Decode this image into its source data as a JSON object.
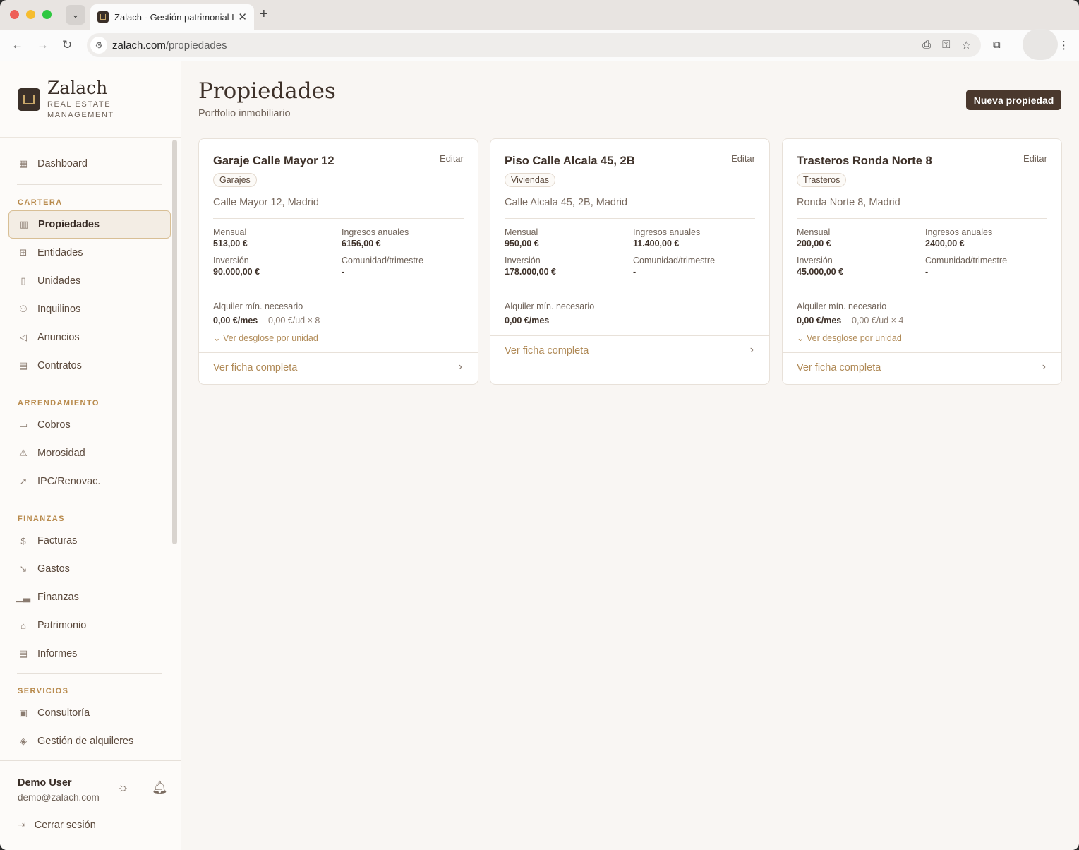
{
  "browser": {
    "tab_title": "Zalach - Gestión patrimonial I",
    "url_host": "zalach.com",
    "url_path": "/propiedades"
  },
  "brand": {
    "name": "Zalach",
    "sub_1": "REAL ESTATE",
    "sub_2": "MANAGEMENT"
  },
  "sidebar": {
    "dashboard": "Dashboard",
    "sections": {
      "cartera": "CARTERA",
      "arrendamiento": "ARRENDAMIENTO",
      "finanzas": "FINANZAS",
      "servicios": "SERVICIOS"
    },
    "items": {
      "propiedades": "Propiedades",
      "entidades": "Entidades",
      "unidades": "Unidades",
      "inquilinos": "Inquilinos",
      "anuncios": "Anuncios",
      "contratos": "Contratos",
      "cobros": "Cobros",
      "morosidad": "Morosidad",
      "ipc": "IPC/Renovac.",
      "facturas": "Facturas",
      "gastos": "Gastos",
      "finanzas": "Finanzas",
      "patrimonio": "Patrimonio",
      "informes": "Informes",
      "consultoria": "Consultoría",
      "gestion": "Gestión de alquileres"
    },
    "user": {
      "name": "Demo User",
      "email": "demo@zalach.com",
      "logout": "Cerrar sesión"
    }
  },
  "main": {
    "title": "Propiedades",
    "subtitle": "Portfolio inmobiliario",
    "new_button": "Nueva propiedad"
  },
  "labels": {
    "edit": "Editar",
    "mensual": "Mensual",
    "ingresos": "Ingresos anuales",
    "inversion": "Inversión",
    "comunidad": "Comunidad/trimestre",
    "alquiler_min": "Alquiler mín. necesario",
    "breakdown": "Ver desglose por unidad",
    "ver_ficha": "Ver ficha completa"
  },
  "properties": [
    {
      "title": "Garaje Calle Mayor 12",
      "tag": "Garajes",
      "address": "Calle Mayor 12, Madrid",
      "mensual": "513,00 €",
      "ingresos": "6156,00 €",
      "inversion": "90.000,00 €",
      "comunidad": "-",
      "min_mes": "0,00 €/mes",
      "min_unit": "0,00 €/ud × 8"
    },
    {
      "title": "Piso Calle Alcala 45, 2B",
      "tag": "Viviendas",
      "address": "Calle Alcala 45, 2B, Madrid",
      "mensual": "950,00 €",
      "ingresos": "11.400,00 €",
      "inversion": "178.000,00 €",
      "comunidad": "-",
      "min_mes": "0,00 €/mes"
    },
    {
      "title": "Trasteros Ronda Norte 8",
      "tag": "Trasteros",
      "address": "Ronda Norte 8, Madrid",
      "mensual": "200,00 €",
      "ingresos": "2400,00 €",
      "inversion": "45.000,00 €",
      "comunidad": "-",
      "min_mes": "0,00 €/mes",
      "min_unit": "0,00 €/ud × 4"
    }
  ]
}
